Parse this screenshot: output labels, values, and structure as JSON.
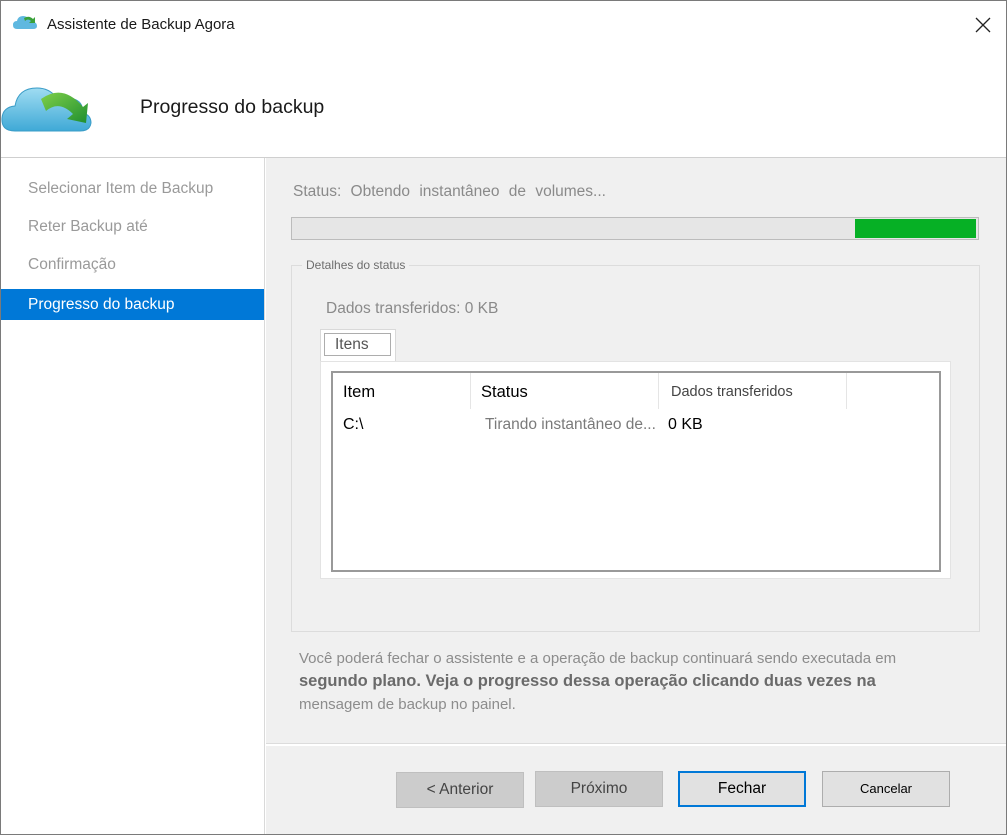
{
  "window": {
    "title": "Assistente de Backup Agora",
    "close_glyph": "✕"
  },
  "header": {
    "title": "Progresso do backup",
    "icon": "cloud-backup-icon"
  },
  "sidebar": {
    "items": [
      {
        "label": "Selecionar Item de Backup",
        "active": false
      },
      {
        "label": "Reter Backup até",
        "active": false
      },
      {
        "label": "Confirmação",
        "active": false
      },
      {
        "label": "Progresso do backup",
        "active": true
      }
    ]
  },
  "main": {
    "status_text": "Status: Obtendo instantâneo de volumes...",
    "progress_fraction": 0.18,
    "progress_segment_start": 0.82,
    "group_title": "Detalhes do status",
    "transferred_text": "Dados transferidos: 0 KB",
    "tab_label": "Itens",
    "columns": [
      "Item",
      "Status",
      "Dados transferidos"
    ],
    "rows": [
      {
        "item": "C:\\",
        "status": "Tirando instantâneo de...",
        "data": "0 KB"
      }
    ],
    "info_line1": "Você poderá fechar o assistente e a operação de backup continuará sendo executada em",
    "info_line2": "segundo plano. Veja o progresso dessa operação clicando duas vezes na",
    "info_line3": "mensagem de backup no painel."
  },
  "buttons": {
    "previous": "<  Anterior",
    "next": "Próximo",
    "close": "Fechar",
    "cancel": "Cancelar"
  },
  "colors": {
    "accent": "#0078d7",
    "progress": "#06b025"
  }
}
